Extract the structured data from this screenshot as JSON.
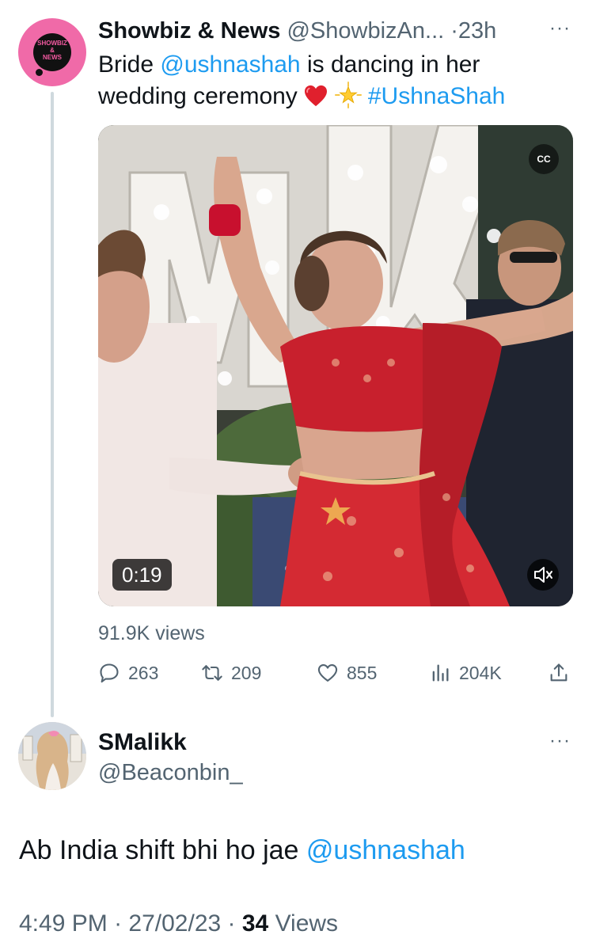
{
  "tweet": {
    "author_avatar_text": [
      "SHOWBIZ",
      "&",
      "NEWS"
    ],
    "display_name": "Showbiz & News",
    "handle": "@ShowbizAn...",
    "separator": "·",
    "time": "23h",
    "more": "···",
    "text_before": "Bride ",
    "mention": "@ushnashah",
    "text_after": " is dancing in her wedding ceremony ",
    "hashtag": "#UshnaShah",
    "media": {
      "cc_label": "CC",
      "duration": "0:19",
      "mute_icon": "speaker-muted-icon"
    },
    "views": "91.9K views",
    "actions": {
      "replies": "263",
      "retweets": "209",
      "likes": "855",
      "impressions": "204K"
    }
  },
  "reply": {
    "display_name": "SMalikk",
    "handle": "@Beaconbin_",
    "more": "···",
    "text": "Ab India shift bhi ho jae ",
    "mention": "@ushnashah",
    "time": "4:49 PM",
    "separator1": " · ",
    "date": "27/02/23",
    "separator2": " · ",
    "view_count": "34",
    "views_label": " Views"
  },
  "colors": {
    "link": "#1d9bf0",
    "secondary_text": "#536471",
    "primary_text": "#0f1419",
    "avatar_pink": "#f06aa8"
  }
}
